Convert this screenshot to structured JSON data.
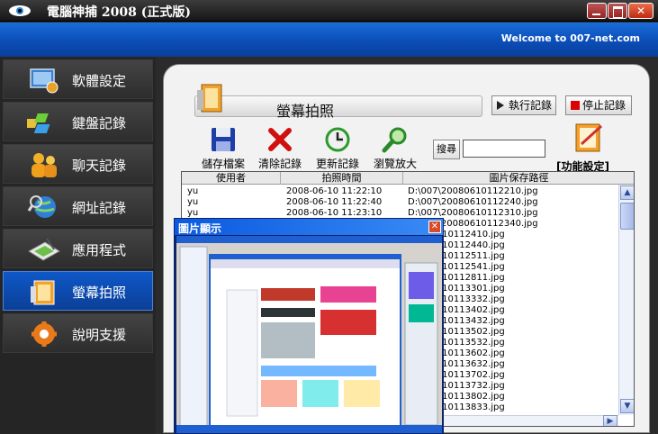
{
  "window": {
    "title": "電腦神捕 2008 (正式版)",
    "close_glyph": "✕"
  },
  "header": {
    "welcome": "Welcome to 007-net.com"
  },
  "sidebar": {
    "items": [
      {
        "label": "軟體設定",
        "icon": "software-settings-icon",
        "active": false
      },
      {
        "label": "鍵盤記錄",
        "icon": "keyboard-log-icon",
        "active": false
      },
      {
        "label": "聊天記錄",
        "icon": "chat-log-icon",
        "active": false
      },
      {
        "label": "網址記錄",
        "icon": "url-log-icon",
        "active": false
      },
      {
        "label": "應用程式",
        "icon": "application-icon",
        "active": false
      },
      {
        "label": "螢幕拍照",
        "icon": "screenshot-icon",
        "active": true
      },
      {
        "label": "說明支援",
        "icon": "help-support-icon",
        "active": false
      }
    ]
  },
  "section": {
    "title": "螢幕拍照"
  },
  "toolbar": {
    "start_label": "執行記錄",
    "stop_label": "停止記錄",
    "save_label": "儲存檔案",
    "clear_label": "清除記錄",
    "refresh_label": "更新記錄",
    "zoom_label": "瀏覽放大",
    "search_label": "搜尋",
    "search_value": "",
    "func_label": "[功能設定]"
  },
  "table": {
    "headers": [
      "使用者",
      "拍照時間",
      "圖片保存路徑"
    ],
    "rows": [
      [
        "yu",
        "2008-06-10 11:22:10",
        "D:\\007\\20080610112210.jpg"
      ],
      [
        "yu",
        "2008-06-10 11:22:40",
        "D:\\007\\20080610112240.jpg"
      ],
      [
        "yu",
        "2008-06-10 11:23:10",
        "D:\\007\\20080610112310.jpg"
      ],
      [
        "yu",
        "2008-06-10 11:23:40",
        "D:\\007\\20080610112340.jpg"
      ],
      [
        "",
        "",
        "20080610112410.jpg"
      ],
      [
        "",
        "",
        "20080610112440.jpg"
      ],
      [
        "",
        "",
        "20080610112511.jpg"
      ],
      [
        "",
        "",
        "20080610112541.jpg"
      ],
      [
        "",
        "",
        "20080610112811.jpg"
      ],
      [
        "",
        "",
        "20080610113301.jpg"
      ],
      [
        "",
        "",
        "20080610113332.jpg"
      ],
      [
        "",
        "",
        "20080610113402.jpg"
      ],
      [
        "",
        "",
        "20080610113432.jpg"
      ],
      [
        "",
        "",
        "20080610113502.jpg"
      ],
      [
        "",
        "",
        "20080610113532.jpg"
      ],
      [
        "",
        "",
        "20080610113602.jpg"
      ],
      [
        "",
        "",
        "20080610113632.jpg"
      ],
      [
        "",
        "",
        "20080610113702.jpg"
      ],
      [
        "",
        "",
        "20080610113732.jpg"
      ],
      [
        "",
        "",
        "20080610113802.jpg"
      ],
      [
        "",
        "",
        "20080610113833.jpg"
      ]
    ]
  },
  "popup": {
    "title": "圖片顯示",
    "close_glyph": "✕"
  },
  "colors": {
    "accent_blue": "#0b4db8",
    "active_nav": "#0f58c9",
    "stop_red": "#dd0000"
  }
}
